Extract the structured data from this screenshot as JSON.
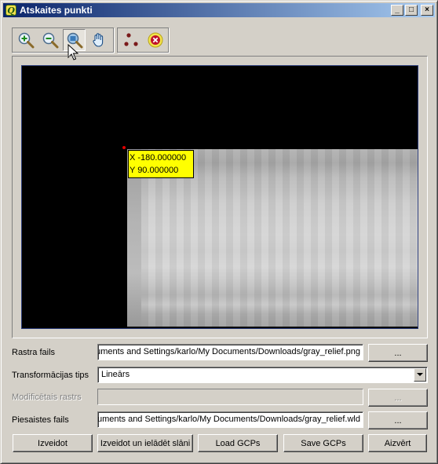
{
  "window": {
    "title": "Atskaites punkti",
    "app_icon": "Q",
    "minimize_glyph": "_",
    "maximize_glyph": "□",
    "close_glyph": "×"
  },
  "toolbar": {
    "tools": [
      {
        "icon": "zoom-in-icon",
        "label": "Zoom In",
        "active": false
      },
      {
        "icon": "zoom-out-icon",
        "label": "Zoom Out",
        "active": false
      },
      {
        "icon": "zoom-to-layer-icon",
        "label": "Zoom to Layer",
        "active": true
      },
      {
        "icon": "pan-hand-icon",
        "label": "Pan",
        "active": false
      },
      {
        "icon": "add-point-icon",
        "label": "Add Point",
        "active": false
      },
      {
        "icon": "delete-point-icon",
        "label": "Delete Point",
        "active": false
      }
    ]
  },
  "canvas": {
    "gcp_label_x": "X -180.000000",
    "gcp_label_y": "Y 90.000000",
    "point_color": "#e00000",
    "label_bg": "#ffff00"
  },
  "form": {
    "raster_label": "Rastra fails",
    "raster_value": "C:/Documents and Settings/karlo/My Documents/Downloads/gray_relief.png",
    "raster_browse": "...",
    "transform_label": "Transformācijas tips",
    "transform_value": "Lineārs",
    "modified_label": "Modificētais rastrs",
    "modified_value": "",
    "modified_browse": "...",
    "world_label": "Piesaistes fails",
    "world_value": "C:/Documents and Settings/karlo/My Documents/Downloads/gray_relief.wld",
    "world_browse": "..."
  },
  "buttons": {
    "create": "Izveidot",
    "create_load": "Izveidot un ielādēt slāni",
    "load_gcps": "Load GCPs",
    "save_gcps": "Save GCPs",
    "close": "Aizvērt"
  }
}
